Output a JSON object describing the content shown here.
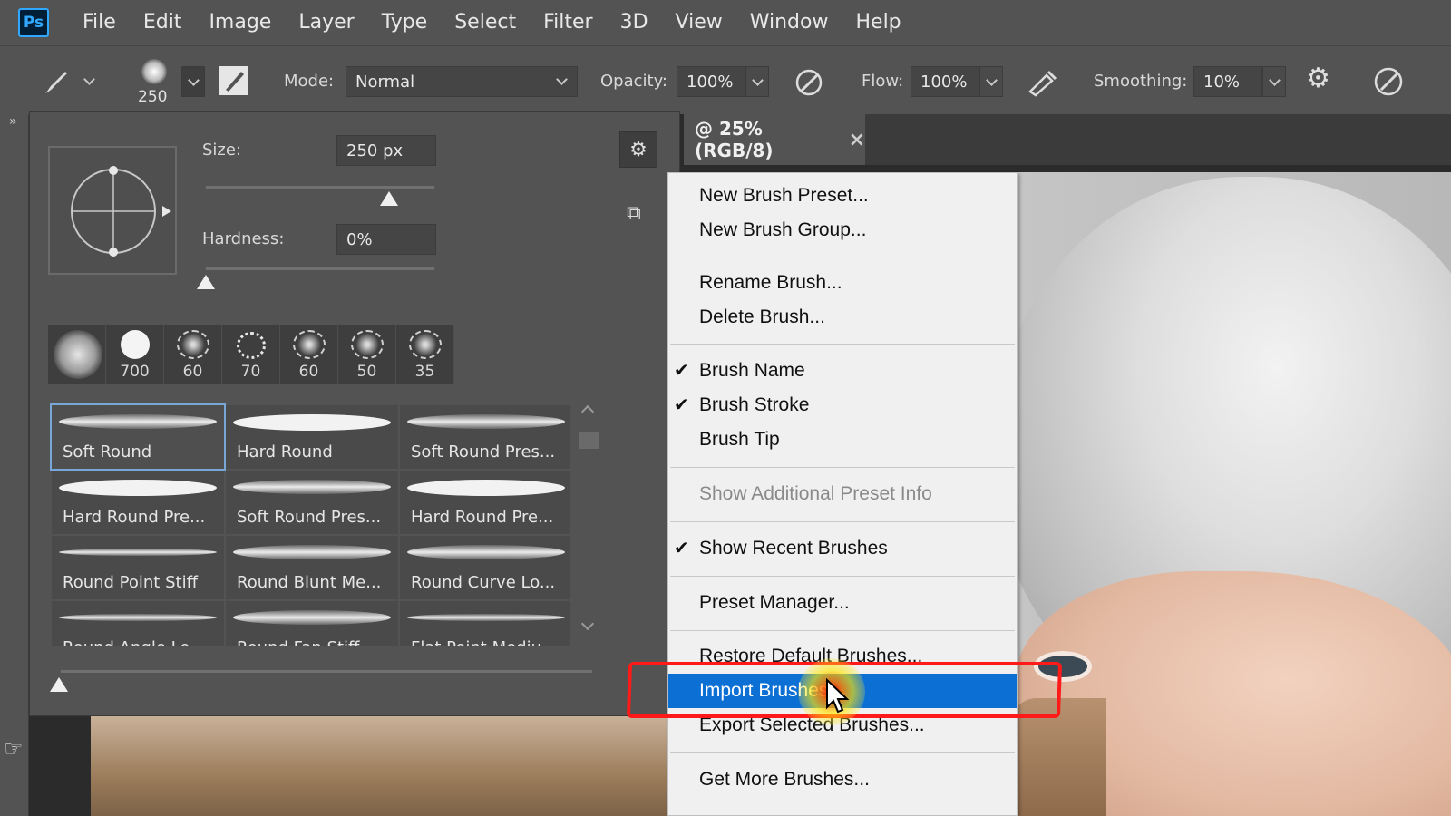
{
  "app": {
    "logo_text": "Ps"
  },
  "menu_bar": [
    "File",
    "Edit",
    "Image",
    "Layer",
    "Type",
    "Select",
    "Filter",
    "3D",
    "View",
    "Window",
    "Help"
  ],
  "options_bar": {
    "brush_size_badge": "250",
    "mode_label": "Mode:",
    "mode_value": "Normal",
    "opacity_label": "Opacity:",
    "opacity_value": "100%",
    "flow_label": "Flow:",
    "flow_value": "100%",
    "smoothing_label": "Smoothing:",
    "smoothing_value": "10%"
  },
  "document": {
    "tab_title": "@ 25% (RGB/8)",
    "close_glyph": "×"
  },
  "brush_panel": {
    "size_label": "Size:",
    "size_value": "250 px",
    "size_slider": 0.8,
    "hardness_label": "Hardness:",
    "hardness_value": "0%",
    "hardness_slider": 0.0,
    "recent_brushes": [
      "",
      "700",
      "60",
      "70",
      "60",
      "50",
      "35"
    ],
    "presets": [
      "Soft Round",
      "Hard Round",
      "Soft Round Pres...",
      "Hard Round Pre...",
      "Soft Round Pres...",
      "Hard Round Pre...",
      "Round Point Stiff",
      "Round Blunt Me...",
      "Round Curve Lo...",
      "Round Angle Lo...",
      "Round Fan Stiff",
      "Flat Point Mediu..."
    ]
  },
  "context_menu": {
    "items": [
      {
        "label": "New Brush Preset...",
        "checked": false,
        "disabled": false
      },
      {
        "label": "New Brush Group...",
        "checked": false,
        "disabled": false
      },
      {
        "label": "Rename Brush...",
        "checked": false,
        "disabled": false
      },
      {
        "label": "Delete Brush...",
        "checked": false,
        "disabled": false
      },
      {
        "label": "Brush Name",
        "checked": true,
        "disabled": false
      },
      {
        "label": "Brush Stroke",
        "checked": true,
        "disabled": false
      },
      {
        "label": "Brush Tip",
        "checked": false,
        "disabled": false
      },
      {
        "label": "Show Additional Preset Info",
        "checked": false,
        "disabled": true
      },
      {
        "label": "Show Recent Brushes",
        "checked": true,
        "disabled": false
      },
      {
        "label": "Preset Manager...",
        "checked": false,
        "disabled": false
      },
      {
        "label": "Restore Default Brushes...",
        "checked": false,
        "disabled": false
      },
      {
        "label": "Import Brushes...",
        "checked": false,
        "disabled": false,
        "highlighted": true
      },
      {
        "label": "Export Selected Brushes...",
        "checked": false,
        "disabled": false
      },
      {
        "label": "Get More Brushes...",
        "checked": false,
        "disabled": false
      }
    ],
    "check_glyph": "✔"
  },
  "colors": {
    "highlight": "#0b6fd4",
    "annotation": "#ff1a1a",
    "panel": "#535353"
  }
}
